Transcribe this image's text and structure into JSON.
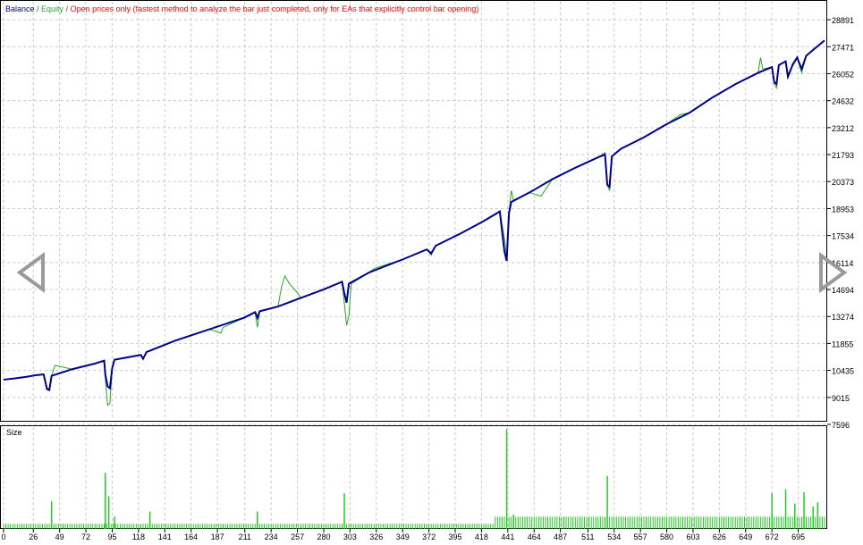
{
  "header": {
    "balance_label": "Balance",
    "sep1": " / ",
    "equity_label": "Equity",
    "sep2": " / ",
    "mode_text": "Open prices only (fastest method to analyze the bar just completed, only for EAs that explicitly control bar opening)"
  },
  "colors": {
    "balance": "#00008b",
    "equity": "#22aa22",
    "mode_text": "#ff0000",
    "volume": "#22cc22",
    "grid": "#c8c8c8",
    "frame": "#000000"
  },
  "icons": {
    "prev": "triangle-left-icon",
    "next": "triangle-right-icon"
  },
  "chart_data": [
    {
      "type": "line",
      "title": "",
      "xlabel": "",
      "ylabel": "",
      "xlim": [
        0,
        718
      ],
      "ylim": [
        7596,
        29600
      ],
      "grid": true,
      "legend": "top-left",
      "x_ticks": [
        0,
        26,
        49,
        72,
        95,
        118,
        141,
        164,
        187,
        211,
        234,
        257,
        280,
        303,
        326,
        349,
        372,
        395,
        418,
        441,
        464,
        487,
        511,
        534,
        557,
        580,
        603,
        626,
        649,
        672,
        695
      ],
      "y_ticks": [
        7596,
        9015,
        10435,
        11855,
        13274,
        14694,
        16114,
        17534,
        18953,
        20373,
        21793,
        23212,
        24632,
        26052,
        27471,
        28891
      ],
      "series": [
        {
          "name": "Balance",
          "points": [
            [
              0,
              9950
            ],
            [
              10,
              10020
            ],
            [
              20,
              10100
            ],
            [
              28,
              10180
            ],
            [
              35,
              10230
            ],
            [
              38,
              9450
            ],
            [
              40,
              9400
            ],
            [
              42,
              10150
            ],
            [
              60,
              10500
            ],
            [
              80,
              10800
            ],
            [
              88,
              10950
            ],
            [
              89,
              10200
            ],
            [
              91,
              9600
            ],
            [
              93,
              9500
            ],
            [
              95,
              10550
            ],
            [
              97,
              11000
            ],
            [
              120,
              11250
            ],
            [
              122,
              11050
            ],
            [
              125,
              11400
            ],
            [
              150,
              12000
            ],
            [
              180,
              12600
            ],
            [
              210,
              13200
            ],
            [
              220,
              13500
            ],
            [
              222,
              13200
            ],
            [
              224,
              13550
            ],
            [
              240,
              13800
            ],
            [
              260,
              14250
            ],
            [
              280,
              14700
            ],
            [
              296,
              15100
            ],
            [
              298,
              14500
            ],
            [
              300,
              14000
            ],
            [
              302,
              15000
            ],
            [
              320,
              15600
            ],
            [
              350,
              16300
            ],
            [
              370,
              16800
            ],
            [
              374,
              16600
            ],
            [
              378,
              17000
            ],
            [
              400,
              17650
            ],
            [
              420,
              18300
            ],
            [
              434,
              18800
            ],
            [
              438,
              16700
            ],
            [
              440,
              16200
            ],
            [
              442,
              18700
            ],
            [
              444,
              19300
            ],
            [
              460,
              19800
            ],
            [
              480,
              20500
            ],
            [
              500,
              21100
            ],
            [
              520,
              21650
            ],
            [
              526,
              21800
            ],
            [
              528,
              20200
            ],
            [
              530,
              20100
            ],
            [
              532,
              21700
            ],
            [
              540,
              22100
            ],
            [
              560,
              22700
            ],
            [
              580,
              23400
            ],
            [
              600,
              24000
            ],
            [
              620,
              24800
            ],
            [
              640,
              25500
            ],
            [
              660,
              26100
            ],
            [
              672,
              26400
            ],
            [
              674,
              25600
            ],
            [
              676,
              25500
            ],
            [
              678,
              26500
            ],
            [
              684,
              26700
            ],
            [
              686,
              25900
            ],
            [
              690,
              26500
            ],
            [
              694,
              26900
            ],
            [
              698,
              26300
            ],
            [
              702,
              27000
            ],
            [
              710,
              27400
            ],
            [
              718,
              27800
            ]
          ]
        },
        {
          "name": "Equity",
          "points": [
            [
              0,
              9950
            ],
            [
              10,
              10020
            ],
            [
              20,
              10100
            ],
            [
              28,
              10180
            ],
            [
              35,
              10230
            ],
            [
              38,
              9500
            ],
            [
              40,
              9450
            ],
            [
              42,
              10150
            ],
            [
              45,
              10700
            ],
            [
              60,
              10500
            ],
            [
              80,
              10800
            ],
            [
              88,
              10950
            ],
            [
              89,
              10000
            ],
            [
              91,
              8600
            ],
            [
              93,
              8700
            ],
            [
              95,
              10500
            ],
            [
              97,
              11000
            ],
            [
              120,
              11250
            ],
            [
              122,
              11050
            ],
            [
              125,
              11400
            ],
            [
              150,
              12000
            ],
            [
              180,
              12600
            ],
            [
              190,
              12400
            ],
            [
              192,
              12700
            ],
            [
              210,
              13200
            ],
            [
              220,
              13500
            ],
            [
              222,
              12700
            ],
            [
              224,
              13550
            ],
            [
              240,
              13800
            ],
            [
              243,
              14800
            ],
            [
              246,
              15400
            ],
            [
              250,
              15000
            ],
            [
              256,
              14600
            ],
            [
              260,
              14250
            ],
            [
              280,
              14700
            ],
            [
              296,
              15100
            ],
            [
              298,
              14000
            ],
            [
              300,
              12800
            ],
            [
              302,
              13300
            ],
            [
              304,
              15000
            ],
            [
              320,
              15600
            ],
            [
              324,
              15800
            ],
            [
              350,
              16300
            ],
            [
              370,
              16800
            ],
            [
              374,
              16500
            ],
            [
              378,
              17000
            ],
            [
              400,
              17650
            ],
            [
              420,
              18300
            ],
            [
              434,
              18800
            ],
            [
              438,
              17400
            ],
            [
              440,
              16400
            ],
            [
              442,
              18700
            ],
            [
              444,
              19900
            ],
            [
              446,
              19400
            ],
            [
              460,
              19800
            ],
            [
              470,
              19600
            ],
            [
              480,
              20500
            ],
            [
              500,
              21100
            ],
            [
              520,
              21650
            ],
            [
              526,
              21900
            ],
            [
              528,
              20200
            ],
            [
              530,
              19900
            ],
            [
              532,
              21700
            ],
            [
              540,
              22100
            ],
            [
              560,
              22700
            ],
            [
              580,
              23400
            ],
            [
              592,
              23900
            ],
            [
              600,
              24000
            ],
            [
              620,
              24800
            ],
            [
              640,
              25500
            ],
            [
              660,
              26100
            ],
            [
              662,
              26900
            ],
            [
              664,
              26300
            ],
            [
              672,
              26400
            ],
            [
              674,
              25500
            ],
            [
              676,
              25300
            ],
            [
              678,
              26500
            ],
            [
              684,
              26700
            ],
            [
              686,
              25800
            ],
            [
              690,
              26600
            ],
            [
              694,
              26900
            ],
            [
              698,
              26100
            ],
            [
              702,
              27000
            ],
            [
              710,
              27400
            ],
            [
              718,
              27800
            ]
          ]
        }
      ]
    },
    {
      "type": "bar",
      "title": "",
      "ylabel": "Size",
      "xlim": [
        0,
        718
      ],
      "ylim": [
        0,
        1.0
      ],
      "grid": true,
      "base_value": 0.05,
      "base_value_late": 0.12,
      "base_step": 2,
      "spikes": [
        [
          42,
          0.27
        ],
        [
          89,
          0.55
        ],
        [
          92,
          0.32
        ],
        [
          97,
          0.12
        ],
        [
          128,
          0.17
        ],
        [
          222,
          0.17
        ],
        [
          298,
          0.35
        ],
        [
          440,
          0.98
        ],
        [
          446,
          0.14
        ],
        [
          528,
          0.52
        ],
        [
          672,
          0.35
        ],
        [
          684,
          0.39
        ],
        [
          692,
          0.25
        ],
        [
          700,
          0.36
        ],
        [
          708,
          0.22
        ],
        [
          712,
          0.26
        ]
      ]
    }
  ]
}
